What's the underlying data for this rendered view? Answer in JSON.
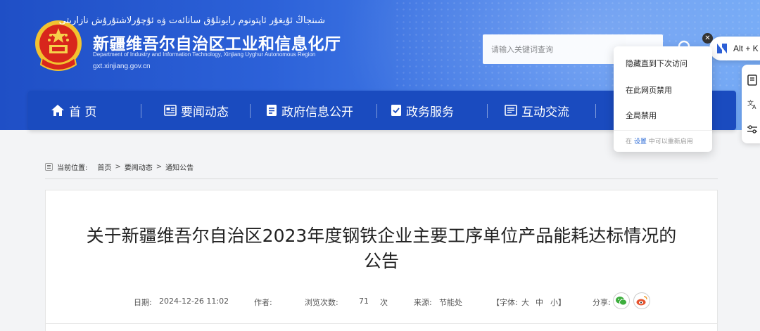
{
  "header": {
    "uyghur_title": "شىنجاڭ ئۇيغۇر ئاپتونوم رايونلۇق سانائەت ۋە ئۇچۇرلاشتۇرۇش نازارىتى",
    "title": "新疆维吾尔自治区工业和信息化厅",
    "english_title": "Department of Industry and Information Technology, Xinjiang Uyghur Autonomous Region",
    "domain": "gxt.xinjiang.gov.cn",
    "search_placeholder": "请输入关键词查询"
  },
  "nav": {
    "items": [
      {
        "label": "首 页",
        "icon": "home-icon"
      },
      {
        "label": "要闻动态",
        "icon": "news-icon"
      },
      {
        "label": "政府信息公开",
        "icon": "info-icon"
      },
      {
        "label": "政务服务",
        "icon": "service-icon"
      },
      {
        "label": "互动交流",
        "icon": "interact-icon"
      }
    ]
  },
  "popup": {
    "items": [
      "隐藏直到下次访问",
      "在此网页禁用",
      "全局禁用"
    ],
    "footer_prefix": "在",
    "footer_link": "设置",
    "footer_suffix": "中可以重新启用"
  },
  "extension": {
    "shortcut": "Alt + K"
  },
  "breadcrumb": {
    "label": "当前位置:",
    "items": [
      "首页",
      "要闻动态",
      "通知公告"
    ]
  },
  "article": {
    "title_line1": "关于新疆维吾尔自治区2023年度钢铁企业主要工序单位产品能耗达标情况的",
    "title_line2": "公告",
    "date_label": "日期:",
    "date": "2024-12-26 11:02",
    "author_label": "作者:",
    "views_label": "浏览次数:",
    "views": "71",
    "views_unit": "次",
    "source_label": "来源:",
    "source": "节能处",
    "font_label": "【字体:",
    "font_large": "大",
    "font_medium": "中",
    "font_small": "小】",
    "share_label": "分享:"
  },
  "colors": {
    "nav_bg": "#1a4bbf",
    "header_start": "#1f4fc6",
    "header_end": "#6ea6f5",
    "wechat": "#3dae3d",
    "weibo": "#e6532e"
  }
}
